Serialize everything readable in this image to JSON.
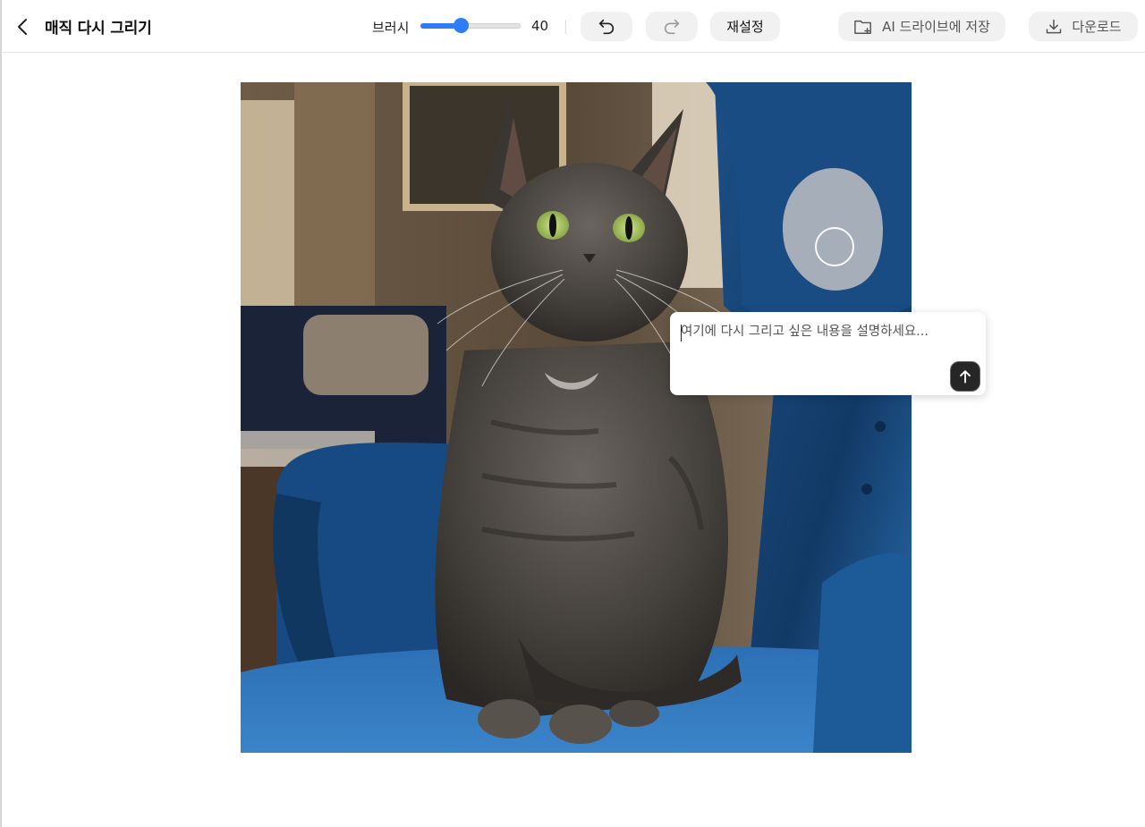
{
  "header": {
    "title": "매직 다시 그리기",
    "brush_label": "브러시",
    "brush_size": "40",
    "brush_level": 0.4,
    "reset_label": "재설정",
    "save_drive_label": "AI 드라이브에 저장",
    "download_label": "다운로드"
  },
  "prompt": {
    "placeholder": "여기에 다시 그리고 싶은 내용을 설명하세요..."
  },
  "colors": {
    "accent": "#2f7df6",
    "chair_blue": "#1e5a94",
    "mask_gray": "#b9bcc2"
  },
  "icons": {
    "back": "chevron-left-icon",
    "undo": "undo-icon",
    "redo": "redo-icon",
    "folder": "folder-add-icon",
    "download": "download-icon",
    "send": "arrow-up-icon"
  }
}
